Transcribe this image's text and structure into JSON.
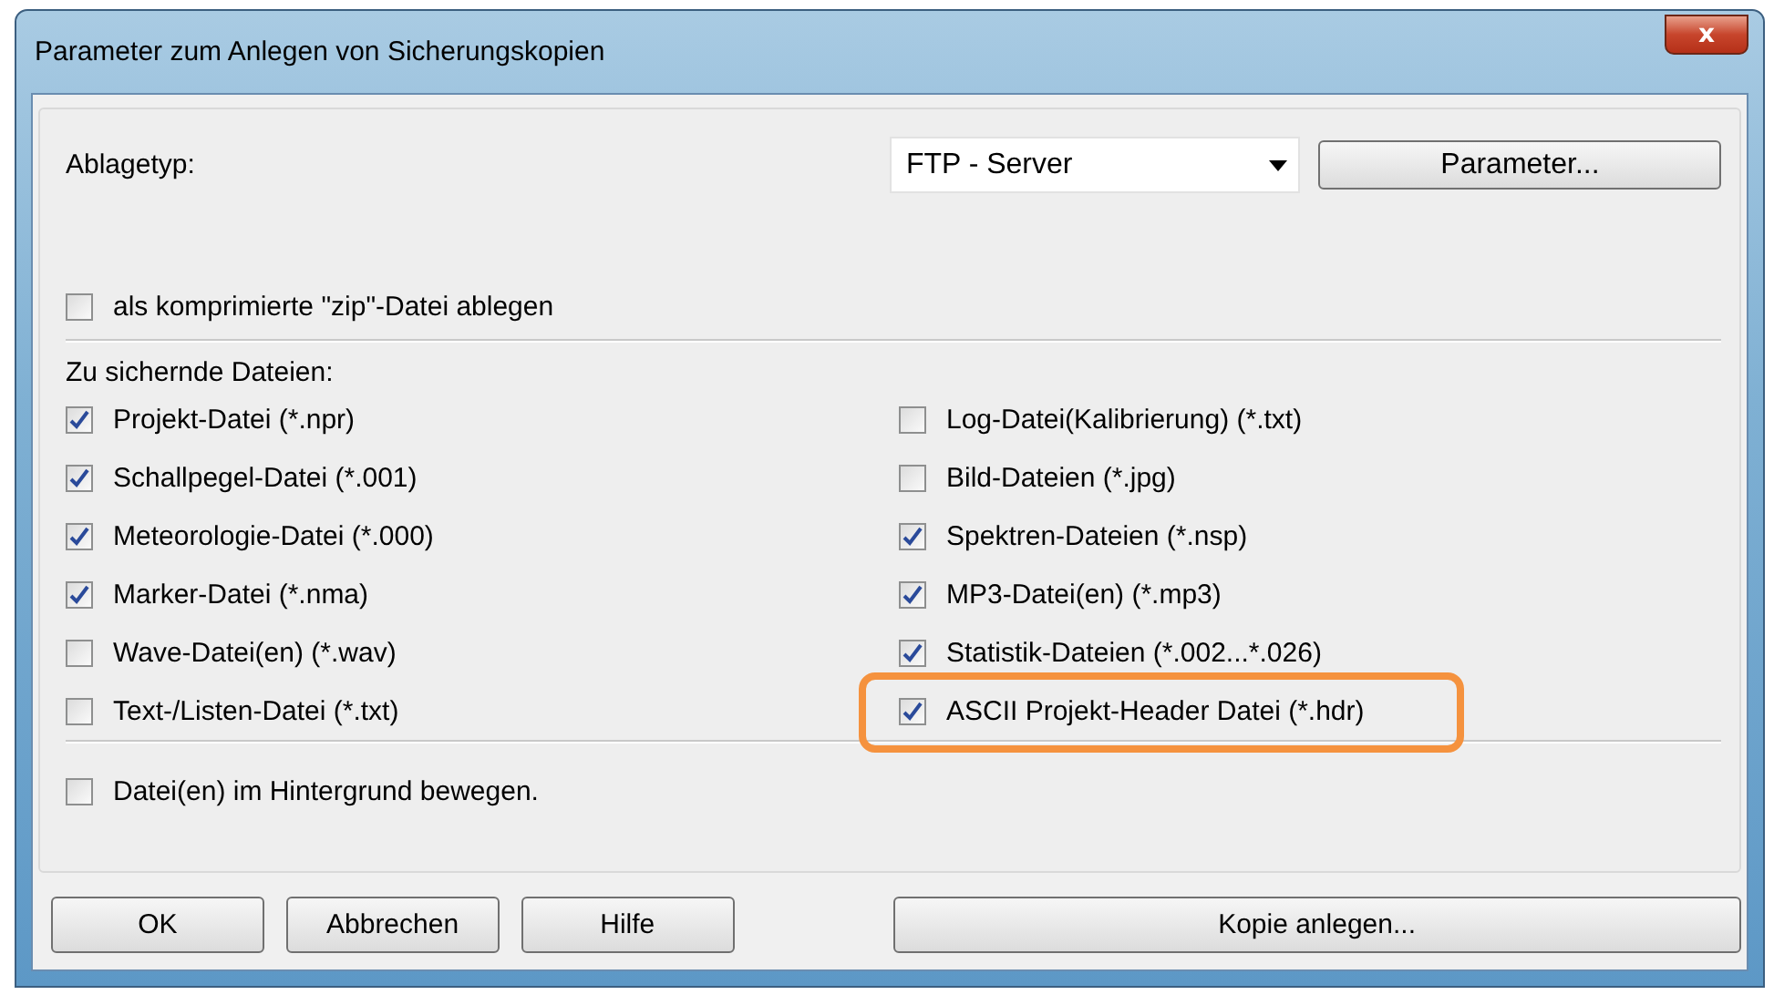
{
  "window": {
    "title": "Parameter zum Anlegen von Sicherungskopien",
    "close_label": "x"
  },
  "storage": {
    "label": "Ablagetyp:",
    "value": "FTP - Server",
    "button": "Parameter..."
  },
  "zip_option": {
    "label": "als komprimierte \"zip\"-Datei ablegen",
    "checked": false
  },
  "files": {
    "heading": "Zu sichernde Dateien:",
    "left": [
      {
        "label": "Projekt-Datei (*.npr)",
        "checked": true,
        "highlighted": false
      },
      {
        "label": "Schallpegel-Datei (*.001)",
        "checked": true,
        "highlighted": false
      },
      {
        "label": "Meteorologie-Datei (*.000)",
        "checked": true,
        "highlighted": false
      },
      {
        "label": "Marker-Datei (*.nma)",
        "checked": true,
        "highlighted": false
      },
      {
        "label": "Wave-Datei(en) (*.wav)",
        "checked": false,
        "highlighted": false
      },
      {
        "label": "Text-/Listen-Datei (*.txt)",
        "checked": false,
        "highlighted": false
      }
    ],
    "right": [
      {
        "label": "Log-Datei(Kalibrierung) (*.txt)",
        "checked": false,
        "highlighted": false
      },
      {
        "label": "Bild-Dateien (*.jpg)",
        "checked": false,
        "highlighted": false
      },
      {
        "label": "Spektren-Dateien (*.nsp)",
        "checked": true,
        "highlighted": false
      },
      {
        "label": "MP3-Datei(en) (*.mp3)",
        "checked": true,
        "highlighted": false
      },
      {
        "label": "Statistik-Dateien (*.002...*.026)",
        "checked": true,
        "highlighted": false
      },
      {
        "label": "ASCII Projekt-Header Datei (*.hdr)",
        "checked": true,
        "highlighted": true
      }
    ]
  },
  "background_option": {
    "label": "Datei(en) im Hintergrund bewegen.",
    "checked": false
  },
  "buttons": [
    "OK",
    "Abbrechen",
    "Hilfe"
  ],
  "main_button": "Kopie anlegen..."
}
